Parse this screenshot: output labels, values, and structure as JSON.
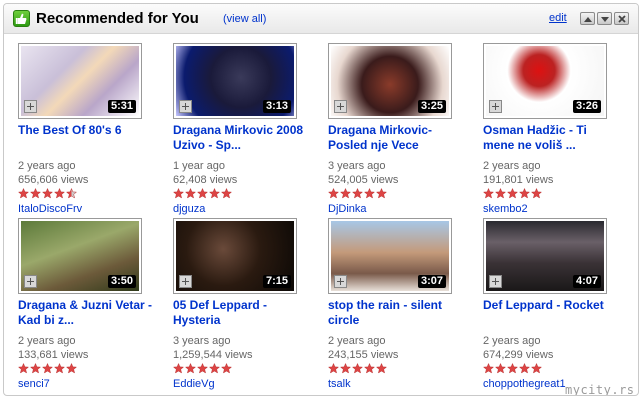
{
  "header": {
    "title": "Recommended for You",
    "view_all": "(view all)",
    "edit": "edit"
  },
  "videos": [
    {
      "title": "The Best Of 80's 6",
      "age": "2 years ago",
      "views": "656,606 views",
      "rating": 4.5,
      "author": "ItaloDiscoFrv",
      "duration": "5:31"
    },
    {
      "title": "Dragana Mirkovic 2008 Uzivo - Sp...",
      "age": "1 year ago",
      "views": "62,408 views",
      "rating": 5,
      "author": "djguza",
      "duration": "3:13"
    },
    {
      "title": "Dragana Mirkovic- Posled nje Vece",
      "age": "3 years ago",
      "views": "524,005 views",
      "rating": 5,
      "author": "DjDinka",
      "duration": "3:25"
    },
    {
      "title": "Osman Hadžic - Ti mene ne voliš ...",
      "age": "2 years ago",
      "views": "191,801 views",
      "rating": 5,
      "author": "skembo2",
      "duration": "3:26"
    },
    {
      "title": "Dragana & Juzni Vetar - Kad bi z...",
      "age": "2 years ago",
      "views": "133,681 views",
      "rating": 5,
      "author": "senci7",
      "duration": "3:50"
    },
    {
      "title": "05 Def Leppard - Hysteria",
      "age": "3 years ago",
      "views": "1,259,544 views",
      "rating": 5,
      "author": "EddieVg",
      "duration": "7:15"
    },
    {
      "title": "stop the rain - silent circle",
      "age": "2 years ago",
      "views": "243,155 views",
      "rating": 5,
      "author": "tsalk",
      "duration": "3:07"
    },
    {
      "title": "Def Leppard - Rocket",
      "age": "2 years ago",
      "views": "674,299 views",
      "rating": 5,
      "author": "choppothegreat1",
      "duration": "4:07"
    }
  ],
  "watermark": "mycity.rs",
  "colors": {
    "link": "#0033cc",
    "star_full": "#dd4444",
    "star_empty": "#cccccc"
  }
}
